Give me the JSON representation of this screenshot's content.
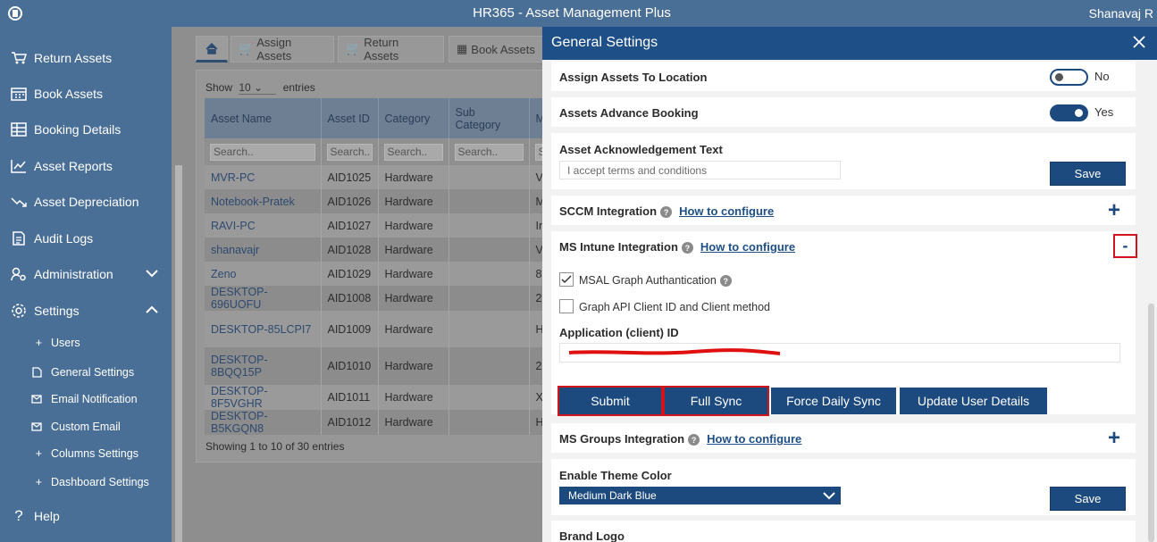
{
  "app": {
    "title": "HR365 - Asset Management Plus",
    "user": "Shanavaj R"
  },
  "sidebar": {
    "items": [
      {
        "label": "Return Assets",
        "icon": "cart-icon"
      },
      {
        "label": "Book Assets",
        "icon": "calendar-icon"
      },
      {
        "label": "Booking Details",
        "icon": "table-icon"
      },
      {
        "label": "Asset Reports",
        "icon": "chart-icon"
      },
      {
        "label": "Asset Depreciation",
        "icon": "trend-down-icon"
      },
      {
        "label": "Audit Logs",
        "icon": "document-icon"
      },
      {
        "label": "Administration",
        "icon": "user-gear-icon"
      },
      {
        "label": "Settings",
        "icon": "gear-icon"
      }
    ],
    "settings_sub": [
      {
        "label": "Users",
        "icon": "plus-icon"
      },
      {
        "label": "General Settings",
        "icon": "file-icon"
      },
      {
        "label": "Email Notification",
        "icon": "mail-icon"
      },
      {
        "label": "Custom Email",
        "icon": "mail-icon"
      },
      {
        "label": "Columns Settings",
        "icon": "plus-icon"
      },
      {
        "label": "Dashboard Settings",
        "icon": "plus-icon"
      }
    ],
    "help": "Help"
  },
  "tabs": {
    "assign": "Assign Assets",
    "return": "Return Assets",
    "book": "Book Assets"
  },
  "table": {
    "show_label": "Show",
    "show_value": "10",
    "entries_label": "entries",
    "columns": [
      "Asset Name",
      "Asset ID",
      "Category",
      "Sub Category",
      "M"
    ],
    "search_placeholder": "Search..",
    "rows": [
      [
        "MVR-PC",
        "AID1025",
        "Hardware",
        "",
        "V"
      ],
      [
        "Notebook-Pratek",
        "AID1026",
        "Hardware",
        "",
        "M"
      ],
      [
        "RAVI-PC",
        "AID1027",
        "Hardware",
        "",
        "Ir"
      ],
      [
        "shanavajr",
        "AID1028",
        "Hardware",
        "",
        "V"
      ],
      [
        "Zeno",
        "AID1029",
        "Hardware",
        "",
        "8"
      ],
      [
        "DESKTOP-696UOFU",
        "AID1008",
        "Hardware",
        "",
        "2"
      ],
      [
        "DESKTOP-85LCPI7",
        "AID1009",
        "Hardware",
        "",
        "H"
      ],
      [
        "DESKTOP-8BQQ15P",
        "AID1010",
        "Hardware",
        "",
        "2"
      ],
      [
        "DESKTOP-8F5VGHR",
        "AID1011",
        "Hardware",
        "",
        "X"
      ],
      [
        "DESKTOP-B5KGQN8",
        "AID1012",
        "Hardware",
        "",
        "H"
      ]
    ],
    "info": "Showing 1 to 10 of 30 entries"
  },
  "panel": {
    "title": "General Settings",
    "assign_location": {
      "label": "Assign Assets To Location",
      "state": "No"
    },
    "advance_booking": {
      "label": "Assets Advance Booking",
      "state": "Yes"
    },
    "ack": {
      "label": "Asset Acknowledgement Text",
      "value": "I accept terms and conditions",
      "save": "Save"
    },
    "sccm": {
      "label": "SCCM Integration",
      "link": "How to configure"
    },
    "intune": {
      "label": "MS Intune Integration",
      "link": "How to configure",
      "collapse": "-",
      "msal": "MSAL Graph Authantication",
      "graph": "Graph API Client ID and Client method",
      "app_id_label": "Application (client) ID",
      "buttons": {
        "submit": "Submit",
        "full_sync": "Full Sync",
        "force_sync": "Force Daily Sync",
        "update_user": "Update User Details"
      }
    },
    "groups": {
      "label": "MS Groups Integration",
      "link": "How to configure"
    },
    "theme": {
      "label": "Enable Theme Color",
      "value": "Medium Dark Blue",
      "save": "Save"
    },
    "brand": {
      "label": "Brand Logo"
    }
  }
}
